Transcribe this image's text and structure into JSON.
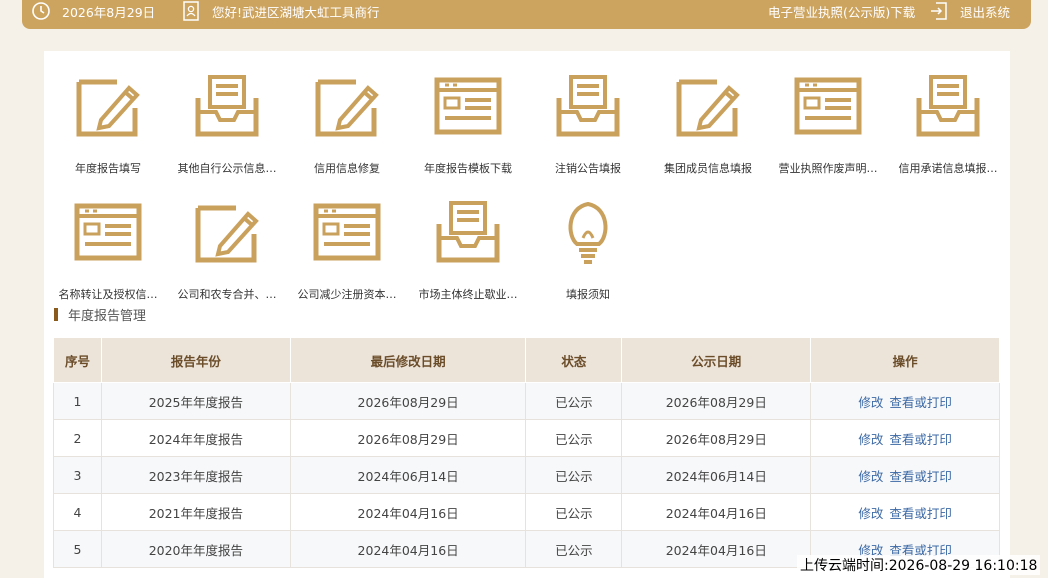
{
  "topbar": {
    "date": "2026年8月29日",
    "greeting": "您好!武进区湖塘大虹工具商行",
    "license_download": "电子营业执照(公示版)下载",
    "logout": "退出系统"
  },
  "tiles": [
    {
      "label": "年度报告填写",
      "icon": "edit-form-icon"
    },
    {
      "label": "其他自行公示信息…",
      "icon": "inbox-tray-icon"
    },
    {
      "label": "信用信息修复",
      "icon": "edit-form-icon"
    },
    {
      "label": "年度报告模板下载",
      "icon": "template-card-icon"
    },
    {
      "label": "注销公告填报",
      "icon": "inbox-tray-icon"
    },
    {
      "label": "集团成员信息填报",
      "icon": "edit-form-icon"
    },
    {
      "label": "营业执照作废声明…",
      "icon": "template-card-icon"
    },
    {
      "label": "信用承诺信息填报…",
      "icon": "inbox-tray-icon"
    },
    {
      "label": "名称转让及授权信…",
      "icon": "template-card-icon"
    },
    {
      "label": "公司和农专合并、…",
      "icon": "edit-form-icon"
    },
    {
      "label": "公司减少注册资本…",
      "icon": "template-card-icon"
    },
    {
      "label": "市场主体终止歇业…",
      "icon": "inbox-tray-icon"
    },
    {
      "label": "填报须知",
      "icon": "lightbulb-icon"
    }
  ],
  "section": {
    "title": "年度报告管理"
  },
  "table": {
    "headers": [
      "序号",
      "报告年份",
      "最后修改日期",
      "状态",
      "公示日期",
      "操作"
    ],
    "rows": [
      {
        "no": "1",
        "year": "2025年年度报告",
        "modified": "2026年08月29日",
        "status": "已公示",
        "published": "2026年08月29日",
        "edit": "修改",
        "view": "查看或打印"
      },
      {
        "no": "2",
        "year": "2024年年度报告",
        "modified": "2026年08月29日",
        "status": "已公示",
        "published": "2026年08月29日",
        "edit": "修改",
        "view": "查看或打印"
      },
      {
        "no": "3",
        "year": "2023年年度报告",
        "modified": "2024年06月14日",
        "status": "已公示",
        "published": "2024年06月14日",
        "edit": "修改",
        "view": "查看或打印"
      },
      {
        "no": "4",
        "year": "2021年年度报告",
        "modified": "2024年04月16日",
        "status": "已公示",
        "published": "2024年04月16日",
        "edit": "修改",
        "view": "查看或打印"
      },
      {
        "no": "5",
        "year": "2020年年度报告",
        "modified": "2024年04月16日",
        "status": "已公示",
        "published": "2024年04月16日",
        "edit": "修改",
        "view": "查看或打印"
      }
    ]
  },
  "upload_stamp": "上传云端时间:2026-08-29 16:10:18",
  "colors": {
    "accent": "#cda45f",
    "link": "#3d6aa6",
    "header_bg": "#ece3d9"
  }
}
